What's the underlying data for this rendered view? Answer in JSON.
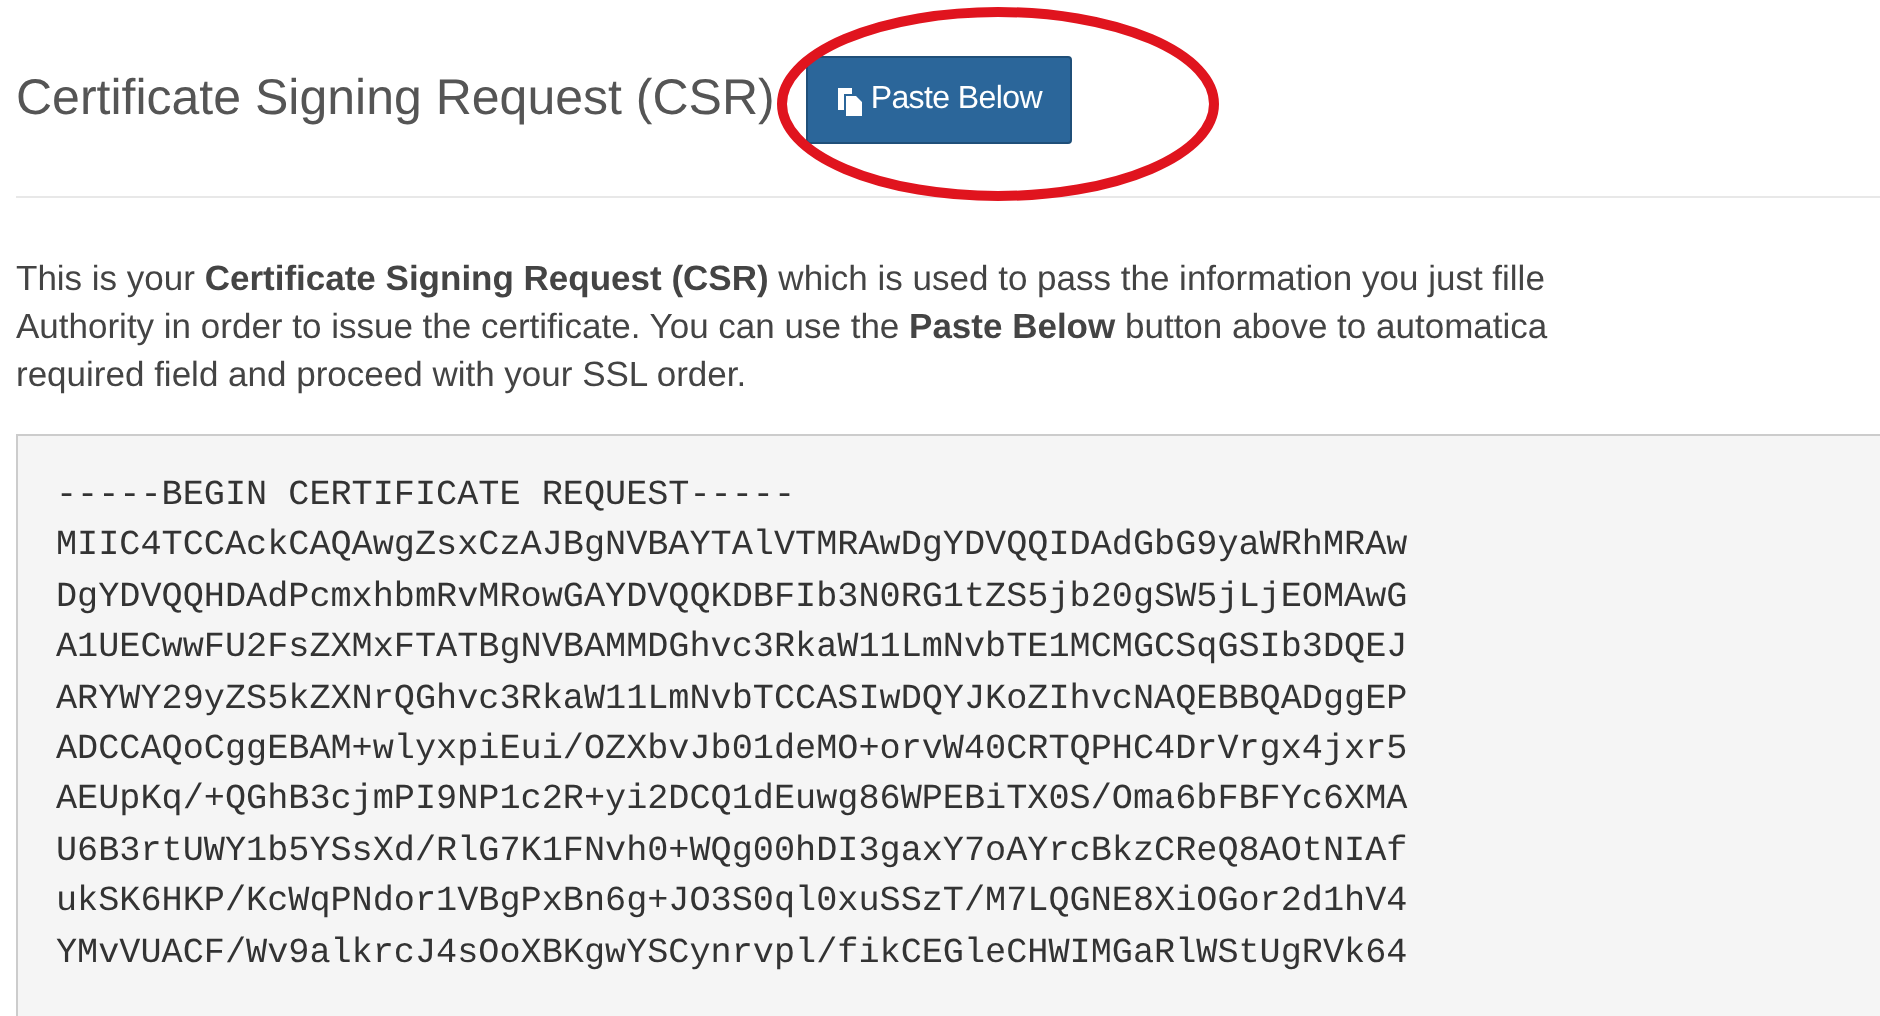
{
  "heading": {
    "title": "Certificate Signing Request (CSR)",
    "button": {
      "label": "Paste Below"
    }
  },
  "annotation": {
    "kind": "ellipse",
    "color": "#e0141e"
  },
  "description": [
    "This is your **Certificate Signing Request (CSR)** which is used to pass the information you just fille",
    "Authority in order to issue the certificate. You can use the **Paste Below** button above to automatica",
    "required field and proceed with your SSL order."
  ],
  "csr_lines": [
    "-----BEGIN CERTIFICATE REQUEST-----",
    "MIIC4TCCAckCAQAwgZsxCzAJBgNVBAYTAlVTMRAwDgYDVQQIDAdGbG9yaWRhMRAw",
    "DgYDVQQHDAdPcmxhbmRvMRowGAYDVQQKDBFIb3N0RG1tZS5jb20gSW5jLjEOMAwG",
    "A1UECwwFU2FsZXMxFTATBgNVBAMMDGhvc3RkaW11LmNvbTE1MCMGCSqGSIb3DQEJ",
    "ARYWY29yZS5kZXNrQGhvc3RkaW11LmNvbTCCASIwDQYJKoZIhvcNAQEBBQADggEP",
    "ADCCAQoCggEBAM+wlyxpiEui/OZXbvJb01deMO+orvW40CRTQPHC4DrVrgx4jxr5",
    "AEUpKq/+QGhB3cjmPI9NP1c2R+yi2DCQ1dEuwg86WPEBiTX0S/Oma6bFBFYc6XMA",
    "U6B3rtUWY1b5YSsXd/RlG7K1FNvh0+WQg00hDI3gaxY7oAYrcBkzCReQ8AOtNIAf",
    "ukSK6HKP/KcWqPNdor1VBgPxBn6g+JO3S0ql0xuSSzT/M7LQGNE8XiOGor2d1hV4",
    "YMvVUACF/Wv9alkrcJ4sOoXBKgwYSCynrvpl/fikCEGleCHWIMGaRlWStUgRVk64"
  ]
}
